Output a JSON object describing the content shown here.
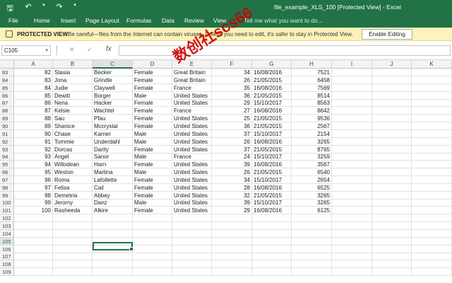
{
  "titlebar": {
    "title": "file_example_XLS_100  [Protected View]  -  Excel",
    "qat": {
      "save_icon": "save-icon",
      "undo_icon": "undo-icon",
      "redo_icon": "redo-icon",
      "customize_icon": "customize-qat-icon"
    }
  },
  "ribbon": {
    "tabs": [
      "File",
      "Home",
      "Insert",
      "Page Layout",
      "Formulas",
      "Data",
      "Review",
      "View"
    ],
    "tell_me": "Tell me what you want to do..."
  },
  "protected_view": {
    "title": "PROTECTED VIEW",
    "message": "Be careful—files from the Internet can contain viruses. Unless you need to edit, it's safer to stay in Protected View.",
    "button": "Enable Editing"
  },
  "formula_bar": {
    "name_box": "C105",
    "formula": ""
  },
  "columns": [
    "A",
    "B",
    "C",
    "D",
    "E",
    "F",
    "G",
    "H",
    "I",
    "J",
    "K"
  ],
  "selected_column": "C",
  "selected_row": "105",
  "rows": [
    {
      "n": "83",
      "A": "82",
      "B": "Stasia",
      "C": "Becker",
      "D": "Female",
      "E": "Great Britain",
      "F": "34",
      "G": "16/08/2016",
      "H": "7521"
    },
    {
      "n": "84",
      "A": "83",
      "B": "Jona",
      "C": "Grindle",
      "D": "Female",
      "E": "Great Britain",
      "F": "26",
      "G": "21/05/2015",
      "H": "6458"
    },
    {
      "n": "85",
      "A": "84",
      "B": "Judie",
      "C": "Claywell",
      "D": "Female",
      "E": "France",
      "F": "35",
      "G": "16/08/2016",
      "H": "7569"
    },
    {
      "n": "86",
      "A": "85",
      "B": "Dewitt",
      "C": "Borger",
      "D": "Male",
      "E": "United States",
      "F": "36",
      "G": "21/05/2015",
      "H": "8514"
    },
    {
      "n": "87",
      "A": "86",
      "B": "Nena",
      "C": "Hacker",
      "D": "Female",
      "E": "United States",
      "F": "29",
      "G": "15/10/2017",
      "H": "8563"
    },
    {
      "n": "88",
      "A": "87",
      "B": "Kelsie",
      "C": "Wachtel",
      "D": "Female",
      "E": "France",
      "F": "27",
      "G": "16/08/2016",
      "H": "8642"
    },
    {
      "n": "89",
      "A": "88",
      "B": "Sau",
      "C": "Pfau",
      "D": "Female",
      "E": "United States",
      "F": "25",
      "G": "21/05/2015",
      "H": "9536"
    },
    {
      "n": "90",
      "A": "89",
      "B": "Shanice",
      "C": "Mccrystal",
      "D": "Female",
      "E": "United States",
      "F": "36",
      "G": "21/05/2015",
      "H": "2567"
    },
    {
      "n": "91",
      "A": "90",
      "B": "Chase",
      "C": "Karner",
      "D": "Male",
      "E": "United States",
      "F": "37",
      "G": "15/10/2017",
      "H": "2154"
    },
    {
      "n": "92",
      "A": "91",
      "B": "Tommie",
      "C": "Underdahl",
      "D": "Male",
      "E": "United States",
      "F": "26",
      "G": "16/08/2016",
      "H": "3265"
    },
    {
      "n": "93",
      "A": "92",
      "B": "Dorcas",
      "C": "Darity",
      "D": "Female",
      "E": "United States",
      "F": "37",
      "G": "21/05/2015",
      "H": "8765"
    },
    {
      "n": "94",
      "A": "93",
      "B": "Angel",
      "C": "Sanor",
      "D": "Male",
      "E": "France",
      "F": "24",
      "G": "15/10/2017",
      "H": "3259"
    },
    {
      "n": "95",
      "A": "94",
      "B": "Willodean",
      "C": "Harn",
      "D": "Female",
      "E": "United States",
      "F": "39",
      "G": "16/08/2016",
      "H": "3567"
    },
    {
      "n": "96",
      "A": "95",
      "B": "Weston",
      "C": "Martina",
      "D": "Male",
      "E": "United States",
      "F": "26",
      "G": "21/05/2015",
      "H": "6540"
    },
    {
      "n": "97",
      "A": "96",
      "B": "Roma",
      "C": "Lafollette",
      "D": "Female",
      "E": "United States",
      "F": "34",
      "G": "15/10/2017",
      "H": "2654"
    },
    {
      "n": "98",
      "A": "97",
      "B": "Felisa",
      "C": "Cail",
      "D": "Female",
      "E": "United States",
      "F": "28",
      "G": "16/08/2016",
      "H": "6525"
    },
    {
      "n": "99",
      "A": "98",
      "B": "Demetria",
      "C": "Abbey",
      "D": "Female",
      "E": "United States",
      "F": "32",
      "G": "21/05/2015",
      "H": "3265"
    },
    {
      "n": "100",
      "A": "99",
      "B": "Jeromy",
      "C": "Danz",
      "D": "Male",
      "E": "United States",
      "F": "39",
      "G": "15/10/2017",
      "H": "3265"
    },
    {
      "n": "101",
      "A": "100",
      "B": "Rasheeda",
      "C": "Alkire",
      "D": "Female",
      "E": "United States",
      "F": "29",
      "G": "16/08/2016",
      "H": "6125"
    },
    {
      "n": "102"
    },
    {
      "n": "103"
    },
    {
      "n": "104"
    },
    {
      "n": "105"
    },
    {
      "n": "106"
    },
    {
      "n": "107"
    },
    {
      "n": "108"
    },
    {
      "n": "109"
    }
  ],
  "watermark": "数创社scs66",
  "colors": {
    "accent": "#217346",
    "protected_bar": "#fdf2b9",
    "watermark": "#cc0000"
  }
}
